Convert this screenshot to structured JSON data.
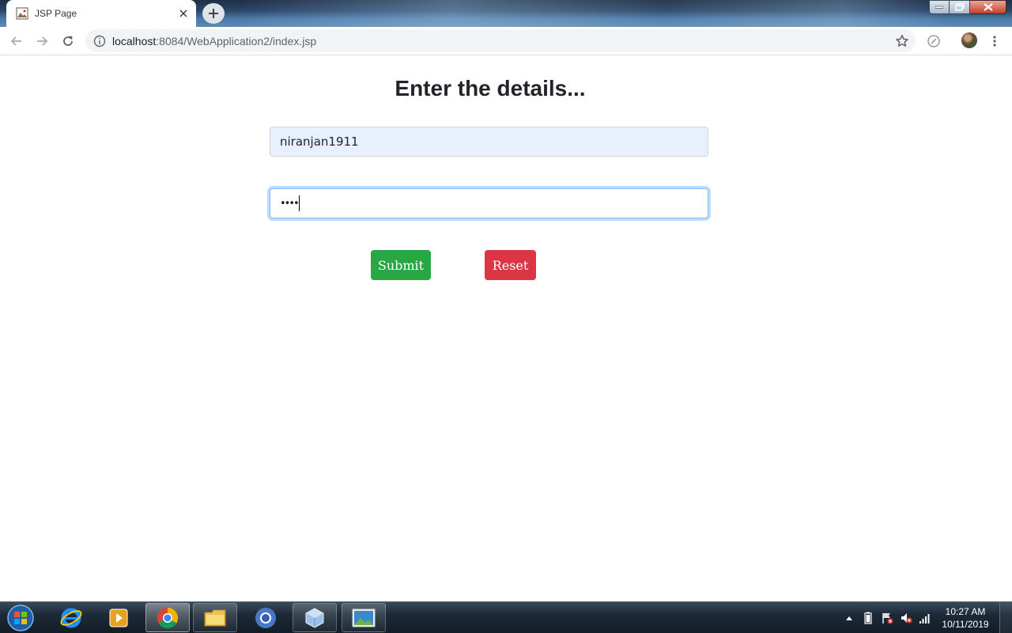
{
  "browser": {
    "tab": {
      "title": "JSP Page"
    },
    "address": {
      "host": "localhost",
      "path": ":8084/WebApplication2/index.jsp"
    }
  },
  "page": {
    "heading": "Enter the details...",
    "username_value": "niranjan1911",
    "password_mask": "••••",
    "submit_label": "Submit",
    "reset_label": "Reset"
  },
  "colors": {
    "submit": "#28a745",
    "reset": "#dc3545",
    "autofill": "#e8f0fe",
    "focus_ring": "#80bdff"
  },
  "taskbar": {
    "time": "10:27 AM",
    "date": "10/11/2019",
    "items": [
      "start-orb-icon",
      "internet-explorer-icon",
      "media-player-icon",
      "chrome-icon",
      "file-explorer-icon",
      "chromium-icon",
      "virtualbox-icon",
      "photo-viewer-icon"
    ]
  }
}
